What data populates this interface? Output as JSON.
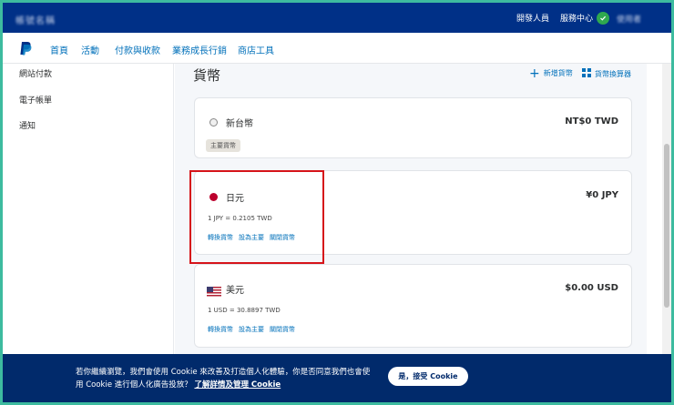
{
  "header": {
    "account_name": "帳號名稱",
    "developer_label": "開發人員",
    "help_label": "服務中心",
    "user_name": "使用者"
  },
  "nav": {
    "items": [
      "首頁",
      "活動",
      "付款與收款",
      "業務成長行銷",
      "商店工具"
    ]
  },
  "sidebar": {
    "items": [
      "網站付款",
      "電子帳單",
      "通知"
    ]
  },
  "main": {
    "title": "貨幣",
    "add_currency_label": "新增貨幣",
    "converter_label": "貨幣換算器"
  },
  "currencies": [
    {
      "name": "新台幣",
      "balance": "NT$0 TWD",
      "badge": "主要貨幣"
    },
    {
      "name": "日元",
      "balance": "¥0 JPY",
      "rate": "1 JPY = 0.2105 TWD",
      "links": [
        "轉換貨幣",
        "設為主要",
        "關閉貨幣"
      ]
    },
    {
      "name": "美元",
      "balance": "$0.00 USD",
      "rate": "1 USD = 30.8897 TWD",
      "links": [
        "轉換貨幣",
        "設為主要",
        "關閉貨幣"
      ]
    }
  ],
  "cookie": {
    "message": "若你繼續瀏覽，我們會使用 Cookie 來改善及打造個人化體驗，你是否同意我們也會使用 Cookie 進行個人化廣告投放？",
    "link_label": "了解詳情及管理 Cookie",
    "accept_label": "是，接受 Cookie"
  },
  "colors": {
    "brand_dark": "#003087",
    "link_blue": "#0070ba",
    "highlight_red": "#d6141a",
    "banner_bg": "#012a6b"
  }
}
